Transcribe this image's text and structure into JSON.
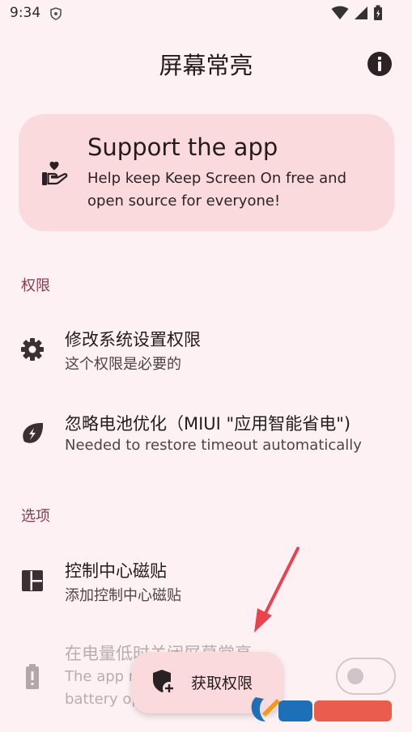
{
  "status_bar": {
    "time": "9:34"
  },
  "app_bar": {
    "title": "屏幕常亮"
  },
  "support_card": {
    "title": "Support the app",
    "description": "Help keep Keep Screen On free and open source for everyone!"
  },
  "sections": {
    "permissions": {
      "header": "权限",
      "items": [
        {
          "title": "修改系统设置权限",
          "summary": "这个权限是必要的"
        },
        {
          "title": "忽略电池优化（MIUI \"应用智能省电\")",
          "summary": "Needed to restore timeout automatically"
        }
      ]
    },
    "options": {
      "header": "选项",
      "items": [
        {
          "title": "控制中心磁贴",
          "summary": "添加控制中心磁贴"
        },
        {
          "title": "在电量低时关闭屏幕常亮",
          "summary_line1": "The app n",
          "summary_line2": "battery op"
        }
      ]
    }
  },
  "fab": {
    "label": "获取权限"
  },
  "toggle": {
    "checked": false
  },
  "colors": {
    "background": "#fdf1f3",
    "card": "#fbdadd",
    "section_header": "#8b3b4e",
    "annotation_arrow": "#e8434f"
  }
}
